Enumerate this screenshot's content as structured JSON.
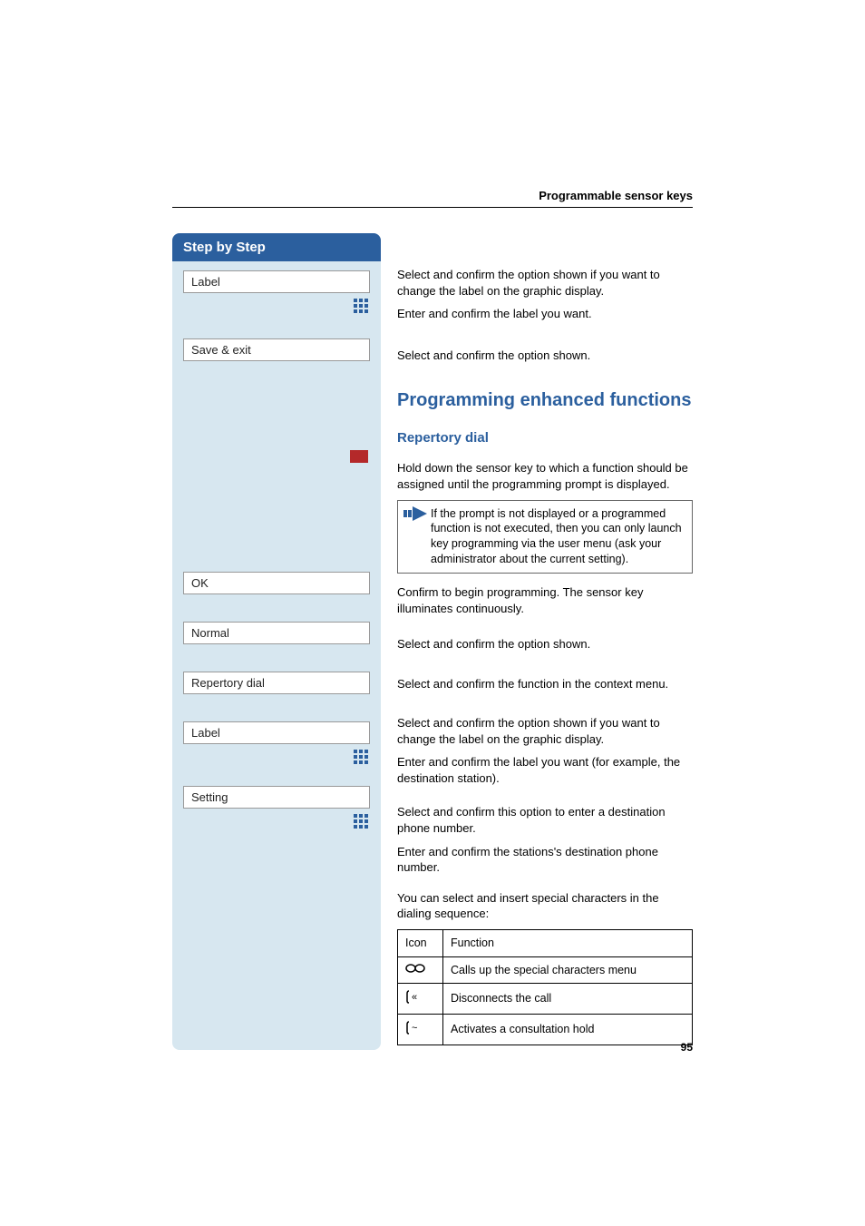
{
  "header": {
    "title": "Programmable sensor keys"
  },
  "sidebar": {
    "title": "Step by Step",
    "items": [
      {
        "type": "option",
        "label": "Label"
      },
      {
        "type": "keypad"
      },
      {
        "type": "option",
        "label": "Save & exit"
      },
      {
        "type": "gap_large"
      },
      {
        "type": "sensor_key"
      },
      {
        "type": "gap_xl"
      },
      {
        "type": "option",
        "label": "OK"
      },
      {
        "type": "gap"
      },
      {
        "type": "option",
        "label": "Normal"
      },
      {
        "type": "gap"
      },
      {
        "type": "option",
        "label": "Repertory dial"
      },
      {
        "type": "gap"
      },
      {
        "type": "option",
        "label": "Label"
      },
      {
        "type": "keypad"
      },
      {
        "type": "gap"
      },
      {
        "type": "option",
        "label": "Setting"
      },
      {
        "type": "keypad"
      }
    ]
  },
  "content": {
    "p1": "Select and confirm the option shown if you want to change the label on the graphic display.",
    "p2": "Enter and confirm the label you want.",
    "p3": "Select and confirm the option shown.",
    "h2": "Programming enhanced functions",
    "h3": "Repertory dial",
    "p4": "Hold down the sensor key to which a function should be assigned until the programming prompt is displayed.",
    "note": "If the prompt is not displayed or a programmed function is not executed, then you can only launch key programming via the user menu (ask your administrator about the current setting).",
    "p5": "Confirm to begin programming. The sensor key illuminates continuously.",
    "p6": "Select and confirm the option shown.",
    "p7": "Select and confirm the function in the context menu.",
    "p8": "Select and confirm the option shown if you want to change the label on the graphic display.",
    "p9": "Enter and confirm the label you want (for example, the destination station).",
    "p10": "Select and confirm this option to enter a destination phone number.",
    "p11": "Enter and confirm the stations's destination phone number.",
    "p12": "You can select and insert special characters in the dialing sequence:",
    "table": {
      "headers": {
        "icon": "Icon",
        "func": "Function"
      },
      "rows": [
        {
          "icon_name": "link-icon",
          "func": "Calls up the special characters menu"
        },
        {
          "icon_name": "disconnect-icon",
          "func": "Disconnects the call"
        },
        {
          "icon_name": "consultation-icon",
          "func": "Activates a consultation hold"
        }
      ]
    }
  },
  "page_number": "95"
}
